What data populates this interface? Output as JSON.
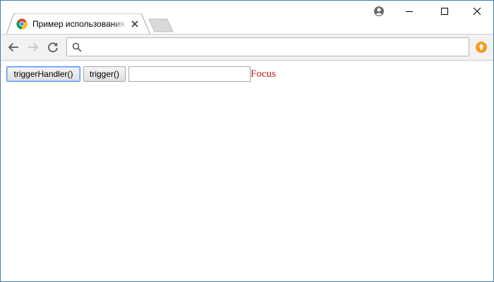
{
  "browser": {
    "tab": {
      "title": "Пример использования"
    },
    "address_bar": {
      "value": "",
      "placeholder": ""
    }
  },
  "page": {
    "buttons": {
      "trigger_handler_label": "triggerHandler()",
      "trigger_label": "trigger()"
    },
    "text_input": {
      "value": ""
    },
    "focus_message": "Focus"
  },
  "colors": {
    "window_border": "#3c7fb1",
    "focus_message": "#c0181b",
    "update_badge": "#f29a1e"
  },
  "icons": {
    "favicon": "chrome-favicon-icon",
    "profile": "profile-icon",
    "back": "back-arrow-icon",
    "forward": "forward-arrow-icon",
    "reload": "reload-icon",
    "search": "search-icon",
    "update": "update-arrow-icon"
  }
}
